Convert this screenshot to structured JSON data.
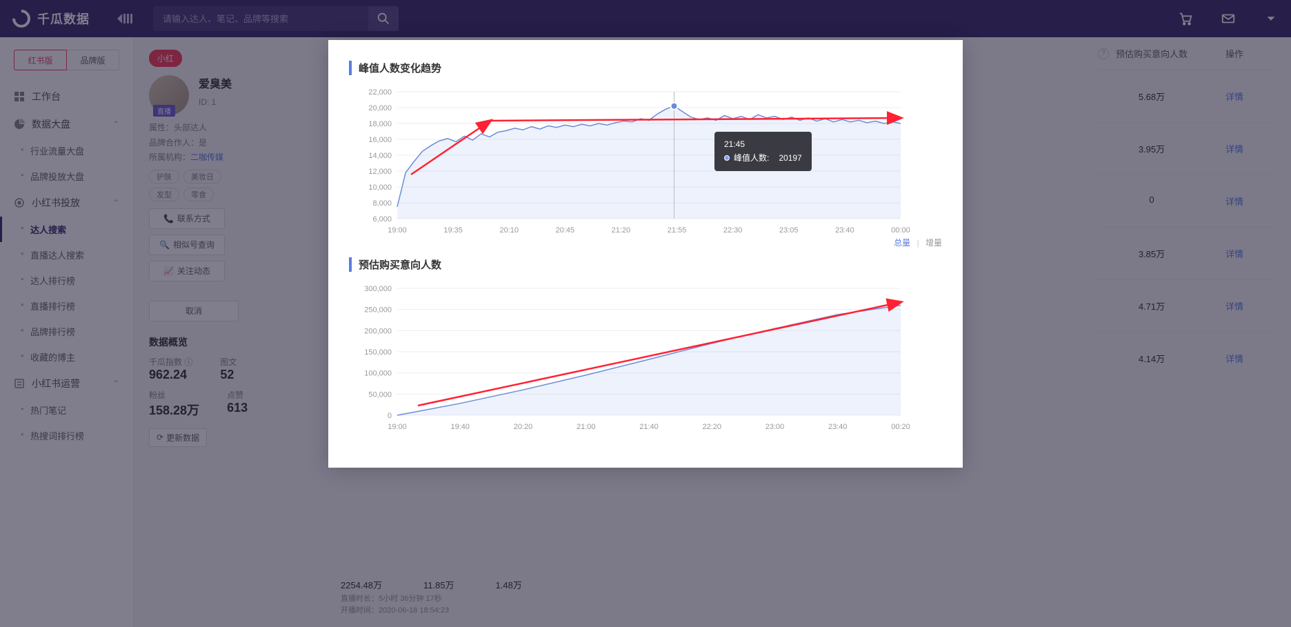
{
  "brand": "千瓜数据",
  "search_placeholder": "请输入达人、笔记、品牌等搜索",
  "version_tabs": [
    "红书版",
    "品牌版"
  ],
  "nav": {
    "workbench": "工作台",
    "dashboard": {
      "label": "数据大盘",
      "items": [
        "行业流量大盘",
        "品牌投放大盘"
      ]
    },
    "xhs_place": {
      "label": "小红书投放",
      "items": [
        "达人搜索",
        "直播达人搜索",
        "达人排行榜",
        "直播排行榜",
        "品牌排行榜",
        "收藏的博主"
      ]
    },
    "xhs_ops": {
      "label": "小红书运营",
      "items": [
        "热门笔记",
        "热搜词排行榜"
      ]
    }
  },
  "profile": {
    "badge": "小红",
    "name": "爱臭美",
    "id_label": "ID: 1",
    "live": "直播",
    "attr_label": "属性：",
    "attr_val": "头部达人",
    "partner_label": "品牌合作人：",
    "partner_val": "是",
    "org_label": "所属机构：",
    "org_val": "二咖传媒",
    "tags": [
      "护肤",
      "美妆日",
      "发型",
      "零食"
    ],
    "contact": "联系方式",
    "similar": "相似号查询",
    "follow": "关注动态",
    "cancel": "取消"
  },
  "overview": {
    "title": "数据概览",
    "qg_label": "千瓜指数",
    "qg_val": "962.24",
    "tw_label": "图文",
    "tw_val": "52",
    "fans_label": "粉丝",
    "fans_val": "158.28万",
    "like_label": "点赞",
    "like_val": "613",
    "refresh": "更新数据"
  },
  "right": {
    "help_icon": "?",
    "col1": "预估购买意向人数",
    "col2": "操作",
    "rows": [
      {
        "v": "5.68万",
        "lk": "详情"
      },
      {
        "v": "3.95万",
        "lk": "详情"
      },
      {
        "v": "0",
        "lk": "详情"
      },
      {
        "v": "3.85万",
        "lk": "详情"
      },
      {
        "v": "4.71万",
        "lk": "详情"
      },
      {
        "v": "4.14万",
        "lk": "详情"
      }
    ]
  },
  "bottom": {
    "a": "2254.48万",
    "b": "11.85万",
    "c": "1.48万",
    "duration_label": "直播时长：",
    "duration": "5小时 36分钟 17秒",
    "start_label": "开播时间：",
    "start": "2020-06-18 18:54:23"
  },
  "modal": {
    "chart1_title": "峰值人数变化趋势",
    "chart2_title": "预估购买意向人数",
    "toggle_total": "总量",
    "toggle_delta": "增量",
    "tooltip": {
      "time": "21:45",
      "label": "峰值人数:",
      "value": "20197"
    }
  },
  "chart_data": [
    {
      "type": "area",
      "title": "峰值人数变化趋势",
      "xlabel": "",
      "ylabel": "",
      "ylim": [
        6000,
        22000
      ],
      "yticks": [
        6000,
        8000,
        10000,
        12000,
        14000,
        16000,
        18000,
        20000,
        22000
      ],
      "xticks": [
        "19:00",
        "19:35",
        "20:10",
        "20:45",
        "21:20",
        "21:55",
        "22:30",
        "23:05",
        "23:40",
        "00:00"
      ],
      "series": [
        {
          "name": "峰值人数",
          "x": [
            "19:00",
            "19:05",
            "19:10",
            "19:15",
            "19:20",
            "19:25",
            "19:30",
            "19:35",
            "19:40",
            "19:45",
            "19:50",
            "19:55",
            "20:00",
            "20:05",
            "20:10",
            "20:15",
            "20:20",
            "20:25",
            "20:30",
            "20:35",
            "20:40",
            "20:45",
            "20:50",
            "20:55",
            "21:00",
            "21:05",
            "21:10",
            "21:15",
            "21:20",
            "21:25",
            "21:30",
            "21:35",
            "21:40",
            "21:45",
            "21:50",
            "21:55",
            "22:00",
            "22:05",
            "22:10",
            "22:15",
            "22:20",
            "22:25",
            "22:30",
            "22:35",
            "22:40",
            "22:45",
            "22:50",
            "22:55",
            "23:00",
            "23:05",
            "23:10",
            "23:15",
            "23:20",
            "23:25",
            "23:30",
            "23:35",
            "23:40",
            "23:45",
            "23:50",
            "23:55",
            "00:00"
          ],
          "values": [
            7500,
            11800,
            13200,
            14500,
            15200,
            15800,
            16100,
            15700,
            16400,
            15900,
            16700,
            16300,
            16900,
            17100,
            17400,
            17200,
            17600,
            17300,
            17700,
            17500,
            17800,
            17600,
            17900,
            17700,
            18000,
            17800,
            18100,
            18300,
            18200,
            18600,
            18400,
            19200,
            19800,
            20197,
            19500,
            18800,
            18500,
            18700,
            18400,
            19000,
            18600,
            18900,
            18500,
            19100,
            18700,
            18900,
            18500,
            18800,
            18400,
            18700,
            18300,
            18600,
            18200,
            18500,
            18200,
            18400,
            18100,
            18300,
            18000,
            18200,
            18000
          ]
        }
      ],
      "highlight": {
        "x": "21:45",
        "y": 20197
      }
    },
    {
      "type": "area",
      "title": "预估购买意向人数",
      "xlabel": "",
      "ylabel": "",
      "ylim": [
        0,
        300000
      ],
      "yticks": [
        0,
        50000,
        100000,
        150000,
        200000,
        250000,
        300000
      ],
      "xticks": [
        "19:00",
        "19:40",
        "20:20",
        "21:00",
        "21:40",
        "22:20",
        "23:00",
        "23:40",
        "00:20"
      ],
      "series": [
        {
          "name": "总量",
          "x": [
            "19:00",
            "19:40",
            "20:20",
            "21:00",
            "21:40",
            "22:20",
            "23:00",
            "23:40",
            "00:20"
          ],
          "values": [
            0,
            28000,
            60000,
            95000,
            132000,
            170000,
            205000,
            238000,
            260000
          ]
        }
      ]
    }
  ]
}
